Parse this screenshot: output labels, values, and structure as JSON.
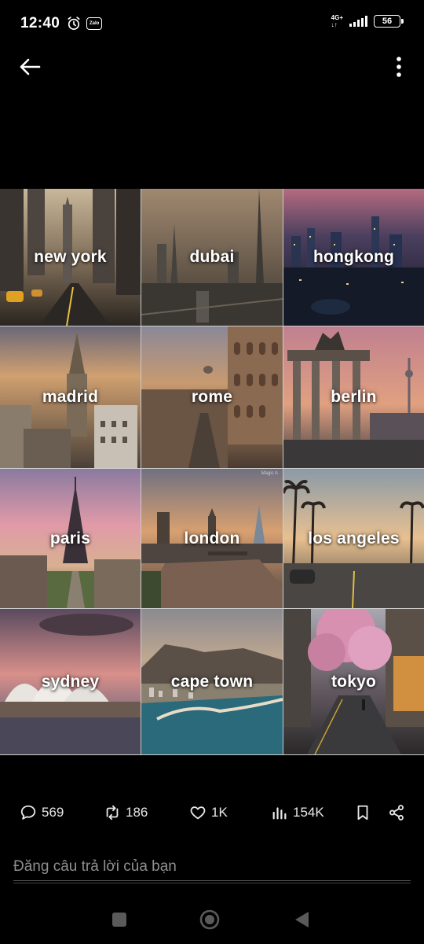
{
  "status_bar": {
    "time": "12:40",
    "zalo_label": "Zalo",
    "network_top": "4G+",
    "network_bottom": "↓↑",
    "battery": "56"
  },
  "nav": {
    "back_icon": "arrow-left-icon",
    "more_icon": "more-vertical-icon"
  },
  "tiles": [
    {
      "label": "new york"
    },
    {
      "label": "dubai"
    },
    {
      "label": "hongkong"
    },
    {
      "label": "madrid"
    },
    {
      "label": "rome"
    },
    {
      "label": "berlin"
    },
    {
      "label": "paris"
    },
    {
      "label": "london"
    },
    {
      "label": "los angeles"
    },
    {
      "label": "sydney"
    },
    {
      "label": "cape town"
    },
    {
      "label": "tokyo"
    }
  ],
  "watermark": "Magic A",
  "actions": {
    "replies": "569",
    "reposts": "186",
    "likes": "1K",
    "views": "154K"
  },
  "reply": {
    "placeholder": "Đăng câu trả lời của bạn"
  },
  "colors": {
    "background": "#000000",
    "text": "#ffffff",
    "muted": "#8e8e8e"
  }
}
